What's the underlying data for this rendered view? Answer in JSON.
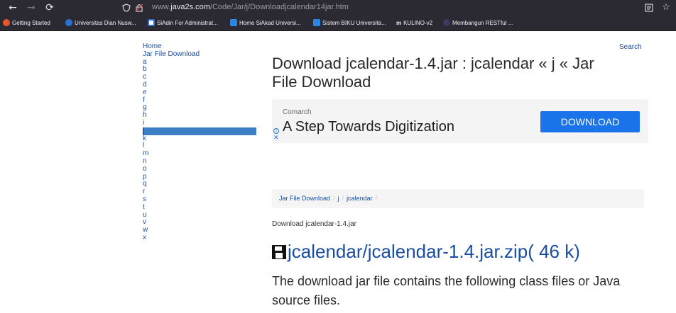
{
  "browser": {
    "url_prefix": "www.",
    "url_domain": "java2s.com",
    "url_path": "/Code/Jar/j/Downloadjcalendar14jar.htm",
    "bookmarks": [
      {
        "label": "Getting Started",
        "color": "#e8562c"
      },
      {
        "label": "Universitas Dian Nusw...",
        "color": "#2b6fd6"
      },
      {
        "label": "SiAdin For Administrat...",
        "color": "#ffffff"
      },
      {
        "label": "Home SiAkad Universi...",
        "color": "#2b86e0"
      },
      {
        "label": "Sistem BIKU Universita...",
        "color": "#2b86e0"
      },
      {
        "label": "KULINO-v2",
        "color": "#2b2a33"
      },
      {
        "label": "Membangun RESTful ...",
        "color": "#2b2a33"
      }
    ]
  },
  "nav": {
    "home": "Home",
    "jar_file_download": "Jar File Download",
    "letters": [
      "a",
      "b",
      "c",
      "d",
      "e",
      "f",
      "g",
      "h",
      "i",
      "j",
      "k",
      "l",
      "m",
      "n",
      "o",
      "p",
      "q",
      "r",
      "s",
      "t",
      "u",
      "v",
      "w",
      "x"
    ],
    "active_letter": "j"
  },
  "search_label": "Search",
  "title": "Download jcalendar-1.4.jar : jcalendar « j « Jar File Download",
  "ad": {
    "brand": "Comarch",
    "headline": "A Step Towards Digitization",
    "cta": "DOWNLOAD"
  },
  "breadcrumb": [
    "Jar File Download",
    "j",
    "jcalendar"
  ],
  "download_caption": "Download jcalendar-1.4.jar",
  "download_link": "jcalendar/jcalendar-1.4.jar.zip( 46 k)",
  "description": "The download jar file contains the following class files or Java source files."
}
